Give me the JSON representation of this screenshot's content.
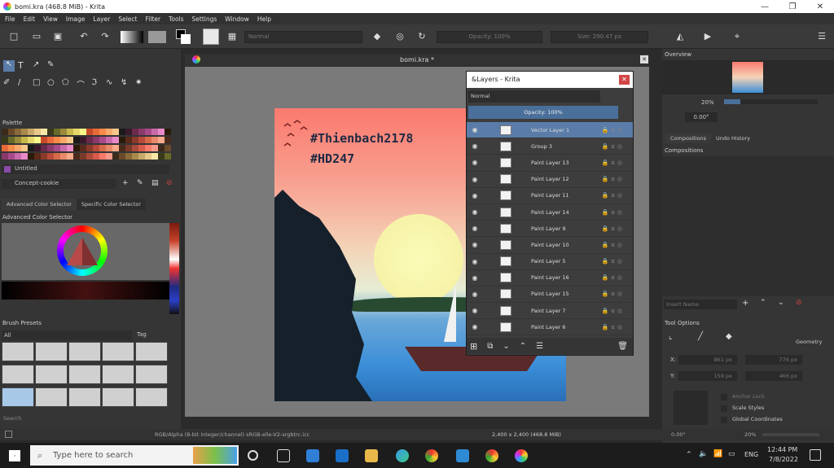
{
  "window": {
    "title": "bomi.kra (468.8 MiB) - Krita",
    "controls": [
      "—",
      "❐",
      "✕"
    ]
  },
  "menu": [
    "File",
    "Edit",
    "View",
    "Image",
    "Layer",
    "Select",
    "Filter",
    "Tools",
    "Settings",
    "Window",
    "Help"
  ],
  "toolbar": {
    "blend_mode": "Normal",
    "opacity": "Opacity: 100%",
    "size": "Size: 290.47 px"
  },
  "document": {
    "tab_title": "bomi.kra *",
    "text_line1": "#Thienbach2178",
    "text_line2": "#HD247"
  },
  "left_panels": {
    "palette_title": "Palette",
    "palette_name": "Untitled",
    "concept_name": "Concept-cookie",
    "tab_advanced": "Advanced Color Selector",
    "tab_specific": "Specific Color Selector",
    "advanced_title": "Advanced Color Selector",
    "brush_presets_title": "Brush Presets",
    "brush_filter": "All",
    "brush_tag": "Tag",
    "search_label": "Search"
  },
  "layers": {
    "window_title": "&Layers - Krita",
    "blend_mode": "Normal",
    "opacity": "Opacity:  100%",
    "items": [
      {
        "name": "Vector Layer 1",
        "selected": true
      },
      {
        "name": "Group 3",
        "selected": false
      },
      {
        "name": "Paint Layer 13",
        "selected": false
      },
      {
        "name": "Paint Layer 12",
        "selected": false
      },
      {
        "name": "Paint Layer 11",
        "selected": false
      },
      {
        "name": "Paint Layer 14",
        "selected": false
      },
      {
        "name": "Paint Layer 9",
        "selected": false
      },
      {
        "name": "Paint Layer 10",
        "selected": false
      },
      {
        "name": "Paint Layer 5",
        "selected": false
      },
      {
        "name": "Paint Layer 16",
        "selected": false
      },
      {
        "name": "Paint Layer 15",
        "selected": false
      },
      {
        "name": "Paint Layer 7",
        "selected": false
      },
      {
        "name": "Paint Layer 6",
        "selected": false
      }
    ]
  },
  "right_panels": {
    "overview_title": "Overview",
    "zoom": "20%",
    "rotation": "0.00°",
    "tab_compositions": "Compositions",
    "tab_undo": "Undo History",
    "compositions_title": "Compositions",
    "insert_name": "Insert Name",
    "tool_options_title": "Tool Options",
    "geometry": "Geometry",
    "x_label": "X:",
    "x_value": "861 px",
    "w_value": "776 px",
    "y_label": "Y:",
    "y_value": "159 px",
    "h_value": "466 px",
    "anchor_lock": "Anchor Lock",
    "scale_styles": "Scale Styles",
    "global_coordinates": "Global Coordinates"
  },
  "status": {
    "color_info": "RGB/Alpha (8-bit integer/channel)  sRGB-elle-V2-srgbtrc.icc",
    "dimensions": "2,400 x 2,400 (468.8 MiB)",
    "rotation": "0.00°",
    "zoom": "20%"
  },
  "taskbar": {
    "search_placeholder": "Type here to search",
    "time": "12:44 PM",
    "date": "7/8/2022",
    "language": "ENG"
  }
}
